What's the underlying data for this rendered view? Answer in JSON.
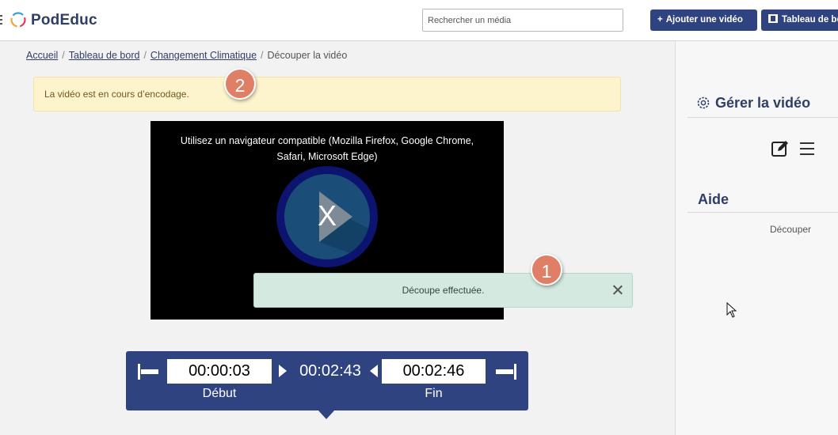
{
  "header": {
    "brand": "PodEduc",
    "search_placeholder": "Rechercher un média",
    "add_video_label": "Ajouter une vidéo",
    "dashboard_label": "Tableau de bord"
  },
  "breadcrumb": {
    "items": [
      "Accueil",
      "Tableau de bord",
      "Changement Climatique"
    ],
    "current": "Découper la vidéo"
  },
  "alert": {
    "text": "La vidéo est en cours d’encodage."
  },
  "annotations": {
    "badge_1": "1",
    "badge_2": "2"
  },
  "video": {
    "message": "Utilisez un navigateur compatible (Mozilla Firefox, Google Chrome, Safari, Microsoft Edge)",
    "overlay_glyph": "X"
  },
  "toast": {
    "text": "Découpe effectuée."
  },
  "cut": {
    "start_time": "00:00:03",
    "duration": "00:02:43",
    "end_time": "00:02:46",
    "start_label": "Début",
    "end_label": "Fin"
  },
  "sidebar": {
    "manage_title": "Gérer la vidéo",
    "help_title": "Aide",
    "help_item": "Découper"
  },
  "colors": {
    "brand": "#2f3e66",
    "primary_button": "#2f4380",
    "alert_bg": "#fdf3cd",
    "toast_bg": "#d4e9df",
    "badge": "#de7f66"
  }
}
